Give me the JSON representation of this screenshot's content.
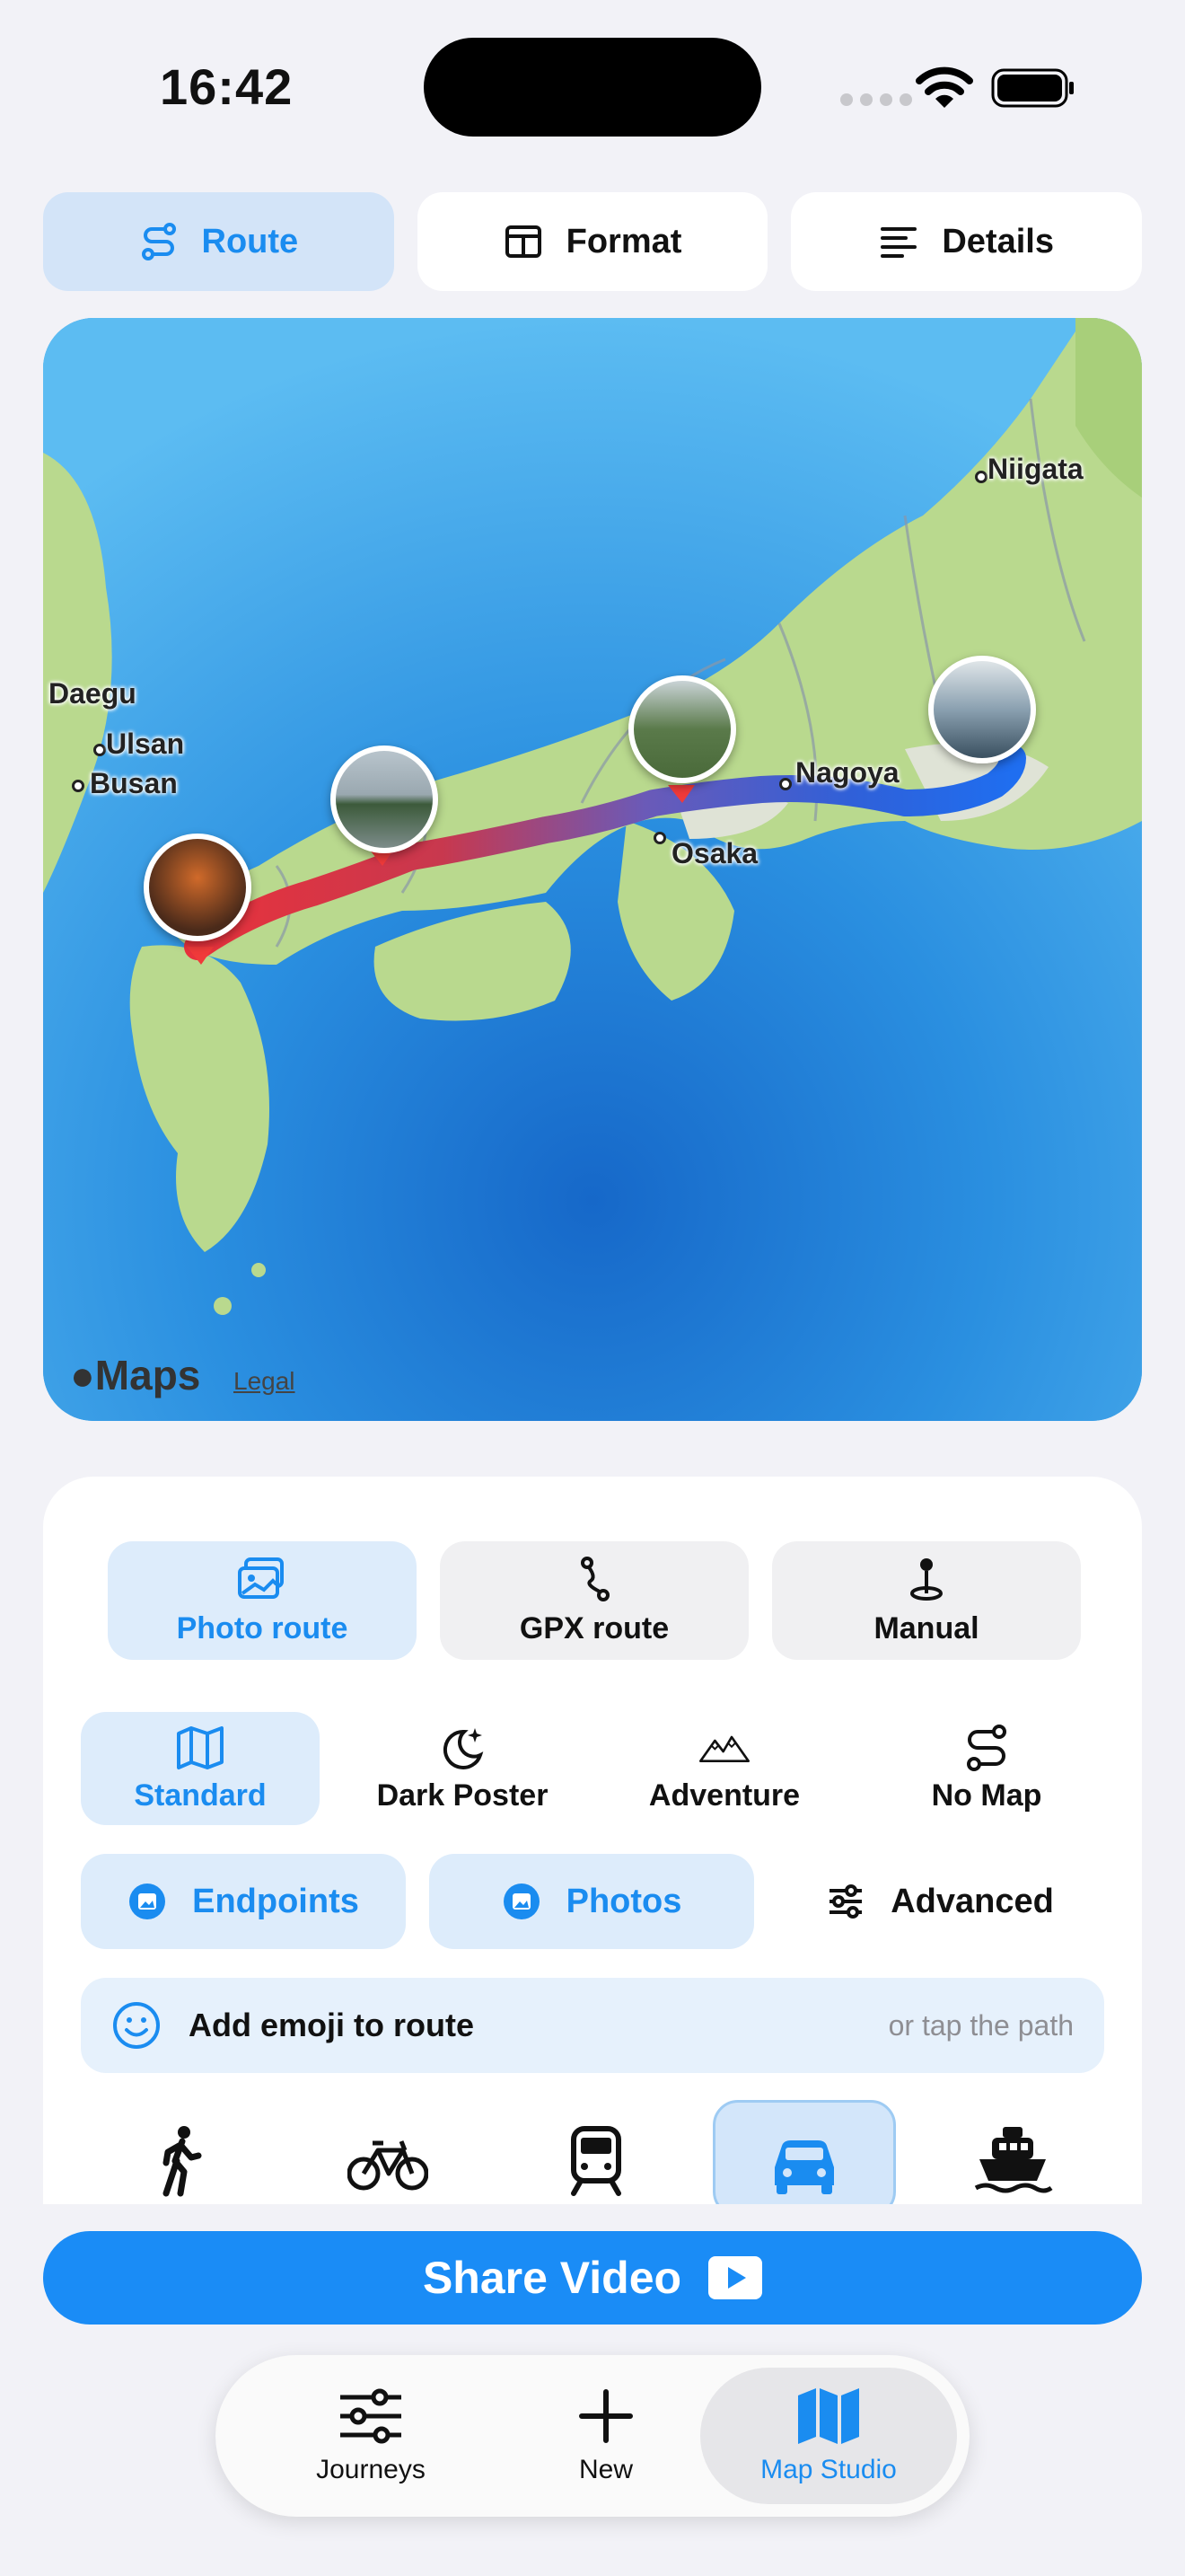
{
  "status": {
    "time": "16:42"
  },
  "topnav": [
    {
      "label": "Route",
      "icon": "route-icon",
      "active": true
    },
    {
      "label": "Format",
      "icon": "layout-icon",
      "active": false
    },
    {
      "label": "Details",
      "icon": "lines-icon",
      "active": false
    }
  ],
  "map": {
    "cities": [
      "Niigata",
      "Daegu",
      "Ulsan",
      "Busan",
      "Nagoya",
      "Osaka"
    ],
    "attribution": "Maps",
    "legal": "Legal",
    "route_colors": {
      "start": "#e8323c",
      "middle": "#6a5ab8",
      "end": "#1f6ef0"
    }
  },
  "source": [
    {
      "label": "Photo route",
      "icon": "photos-icon",
      "active": true
    },
    {
      "label": "GPX route",
      "icon": "path-icon",
      "active": false
    },
    {
      "label": "Manual",
      "icon": "pin-icon",
      "active": false
    }
  ],
  "styles": [
    {
      "label": "Standard",
      "icon": "map-icon",
      "active": true
    },
    {
      "label": "Dark Poster",
      "icon": "moon-icon",
      "active": false
    },
    {
      "label": "Adventure",
      "icon": "mountains-icon",
      "active": false
    },
    {
      "label": "No Map",
      "icon": "route-icon",
      "active": false
    }
  ],
  "options": [
    {
      "label": "Endpoints",
      "icon": "photo-badge-icon",
      "active": true
    },
    {
      "label": "Photos",
      "icon": "photo-badge-icon",
      "active": true
    },
    {
      "label": "Advanced",
      "icon": "sliders-icon",
      "active": false
    }
  ],
  "emoji": {
    "label": "Add emoji to route",
    "hint": "or tap the path"
  },
  "transport_modes": [
    {
      "name": "walk-icon",
      "active": false
    },
    {
      "name": "bicycle-icon",
      "active": false
    },
    {
      "name": "train-icon",
      "active": false
    },
    {
      "name": "car-icon",
      "active": true
    },
    {
      "name": "ferry-icon",
      "active": false
    }
  ],
  "share": {
    "label": "Share Video"
  },
  "tabbar": [
    {
      "label": "Journeys",
      "icon": "sliders-icon",
      "active": false
    },
    {
      "label": "New",
      "icon": "plus-icon",
      "active": false
    },
    {
      "label": "Map Studio",
      "icon": "map-icon",
      "active": true
    }
  ],
  "colors": {
    "accent": "#1a8cf0",
    "accent_bg": "#ddecfb"
  }
}
